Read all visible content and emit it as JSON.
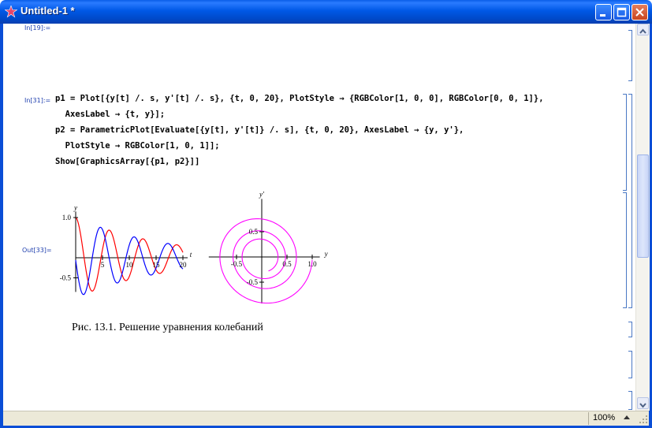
{
  "window": {
    "title": "Untitled-1 *"
  },
  "cells": {
    "in19_label": "In[19]:=",
    "in31_label": "In[31]:=",
    "out33_label": "Out[33]=",
    "code_lines": [
      "p1 = Plot[{y[t] /. s, y'[t] /. s}, {t, 0, 20}, PlotStyle → {RGBColor[1, 0, 0], RGBColor[0, 0, 1]},",
      "  AxesLabel → {t, y}];",
      "p2 = ParametricPlot[Evaluate[{y[t], y'[t]} /. s], {t, 0, 20}, AxesLabel → {y, y'},",
      "  PlotStyle → RGBColor[1, 0, 1]];",
      "Show[GraphicsArray[{p1, p2}]]"
    ]
  },
  "caption": "Рис. 13.1. Решение уравнения колебаний",
  "status": {
    "zoom": "100%"
  },
  "colors": {
    "titlebar": "#0058e6",
    "label_blue": "#1f3fae",
    "red_curve": "#ff0000",
    "blue_curve": "#0000ff",
    "magenta_curve": "#ff00ff"
  },
  "icons": {
    "app": "mathematica-star-icon",
    "minimize": "minimize-icon",
    "maximize": "maximize-icon",
    "close": "close-icon"
  },
  "chart_data": [
    {
      "type": "line",
      "x": [
        0,
        20
      ],
      "xlabel": "t",
      "ylabel": "y",
      "xticks": [
        "5",
        "10",
        "15",
        "20"
      ],
      "yticks": [
        "1.0",
        "-0.5"
      ],
      "xlim": [
        0,
        20
      ],
      "ylim": [
        -0.85,
        1.1
      ],
      "series": [
        {
          "color": "#ff0000",
          "formula": "cos(t)*exp(-0.06t)"
        },
        {
          "color": "#0000ff",
          "formula": "derivative"
        }
      ]
    },
    {
      "type": "scatter",
      "xlabel": "y",
      "ylabel": "y'",
      "xticks": [
        "-0.5",
        "0.5",
        "1.0"
      ],
      "yticks": [
        "0.5",
        "-0.5"
      ],
      "xlim": [
        -1.05,
        1.05
      ],
      "ylim": [
        -1.05,
        1.05
      ],
      "series": [
        {
          "color": "#ff00ff"
        }
      ]
    }
  ]
}
